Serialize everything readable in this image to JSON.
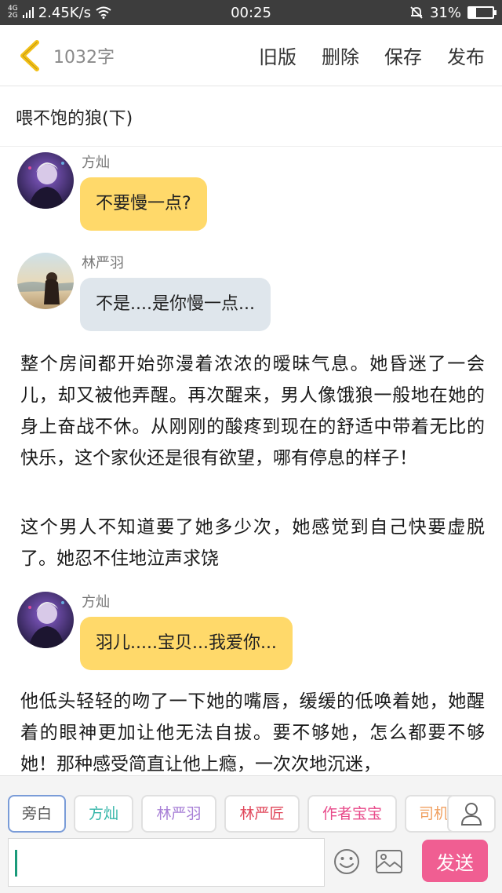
{
  "status_bar": {
    "network_top": "4G",
    "network_bottom": "2G",
    "speed": "2.45K/s",
    "time": "00:25",
    "battery": "31%",
    "battery_level": 0.31
  },
  "toolbar": {
    "word_count": "1032字",
    "old_version": "旧版",
    "delete": "删除",
    "save": "保存",
    "publish": "发布"
  },
  "story": {
    "title": "喂不饱的狼(下)"
  },
  "content": {
    "msg1": {
      "speaker": "方灿",
      "text": "不要慢一点?"
    },
    "msg2": {
      "speaker": "林严羽",
      "text": "不是....是你慢一点..."
    },
    "para1": "整个房间都开始弥漫着浓浓的暧昧气息。她昏迷了一会儿，却又被他弄醒。再次醒来，男人像饿狼一般地在她的身上奋战不休。从刚刚的酸疼到现在的舒适中带着无比的快乐，这个家伙还是很有欲望，哪有停息的样子！",
    "para2": "这个男人不知道要了她多少次，她感觉到自己快要虚脱了。她忍不住地泣声求饶",
    "msg3": {
      "speaker": "方灿",
      "text": "羽儿.....宝贝...我爱你..."
    },
    "para3": "他低头轻轻的吻了一下她的嘴唇，缓缓的低唤着她，她醒着的眼神更加让他无法自拔。要不够她，怎么都要不够她！那种感受简直让他上瘾，一次次地沉迷，"
  },
  "roles": [
    {
      "label": "旁白",
      "color": "#555555"
    },
    {
      "label": "方灿",
      "color": "#33b5a8"
    },
    {
      "label": "林严羽",
      "color": "#a77fd6"
    },
    {
      "label": "林严匠",
      "color": "#e0475a"
    },
    {
      "label": "作者宝宝",
      "color": "#e84a8a"
    },
    {
      "label": "司机",
      "color": "#f0a060"
    }
  ],
  "input": {
    "placeholder": "",
    "send_label": "发送"
  },
  "colors": {
    "accent_yellow": "#ffd96a",
    "bubble_blue": "#dfe6ec",
    "send_pink": "#f05e92",
    "back_arrow": "#f2c018"
  }
}
